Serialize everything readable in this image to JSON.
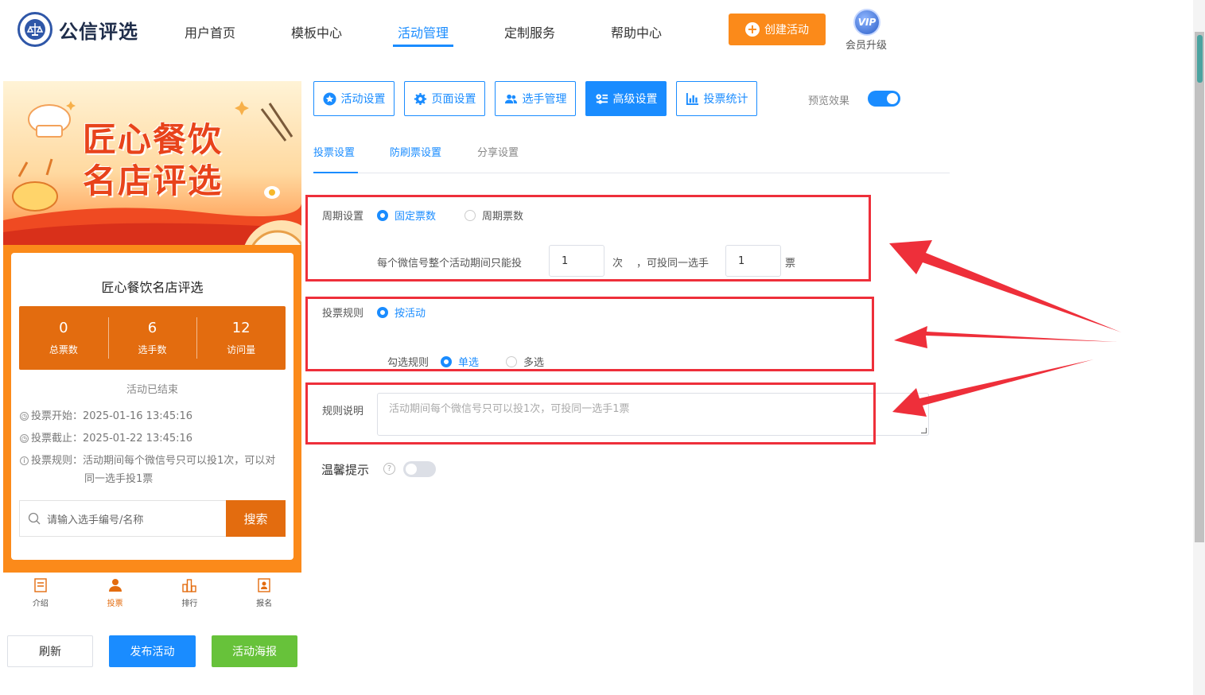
{
  "header": {
    "app_name": "公信评选",
    "nav": [
      "用户首页",
      "模板中心",
      "活动管理",
      "定制服务",
      "帮助中心"
    ],
    "active_nav": "活动管理",
    "create_button": "创建活动",
    "vip_badge": "VIP",
    "vip_label": "会员升级"
  },
  "preview": {
    "banner_title_line1": "匠心餐饮",
    "banner_title_line2": "名店评选",
    "card_title": "匠心餐饮名店评选",
    "stats": [
      {
        "value": "0",
        "label": "总票数"
      },
      {
        "value": "6",
        "label": "选手数"
      },
      {
        "value": "12",
        "label": "访问量"
      }
    ],
    "status": "活动已结束",
    "vote_start": "投票开始：2025-01-16 13:45:16",
    "vote_end": "投票截止：2025-01-22 13:45:16",
    "vote_rule_line1": "投票规则：活动期间每个微信号只可以投1次，可以对",
    "vote_rule_line2": "同一选手投1票",
    "search_placeholder": "请输入选手编号/名称",
    "search_button": "搜索",
    "tabs": [
      "介绍",
      "投票",
      "排行",
      "报名"
    ],
    "active_tab": "投票",
    "colors": {
      "brand_orange": "#e36c0f",
      "card_frame": "#fb8a1a"
    }
  },
  "actions": {
    "refresh": "刷新",
    "publish": "发布活动",
    "poster": "活动海报"
  },
  "toolbar": {
    "buttons": [
      "活动设置",
      "页面设置",
      "选手管理",
      "高级设置",
      "投票统计"
    ],
    "active": "高级设置",
    "preview_label": "预览效果",
    "preview_on": true
  },
  "subtabs": {
    "items": [
      "投票设置",
      "防刷票设置",
      "分享设置"
    ],
    "active": "投票设置"
  },
  "form": {
    "cycle_label": "周期设置",
    "cycle_options": [
      "固定票数",
      "周期票数"
    ],
    "cycle_selected": "固定票数",
    "limit_prefix": "每个微信号整个活动期间只能投",
    "times_value": "1",
    "times_unit": "次",
    "same_player_text": "，可投同一选手",
    "votes_value": "1",
    "votes_unit": "票",
    "rule_label": "投票规则",
    "rule_option": "按活动",
    "check_rule_label": "勾选规则",
    "check_options": [
      "单选",
      "多选"
    ],
    "check_selected": "单选",
    "desc_label": "规则说明",
    "desc_placeholder": "活动期间每个微信号只可以投1次，可投同一选手1票",
    "tip_label": "温馨提示",
    "tip_help": "?",
    "tip_on": false
  },
  "colors": {
    "accent": "#1a8cff",
    "highlight": "#ee2f3a",
    "create": "#fb8a1a",
    "poster_green": "#67c23a"
  }
}
